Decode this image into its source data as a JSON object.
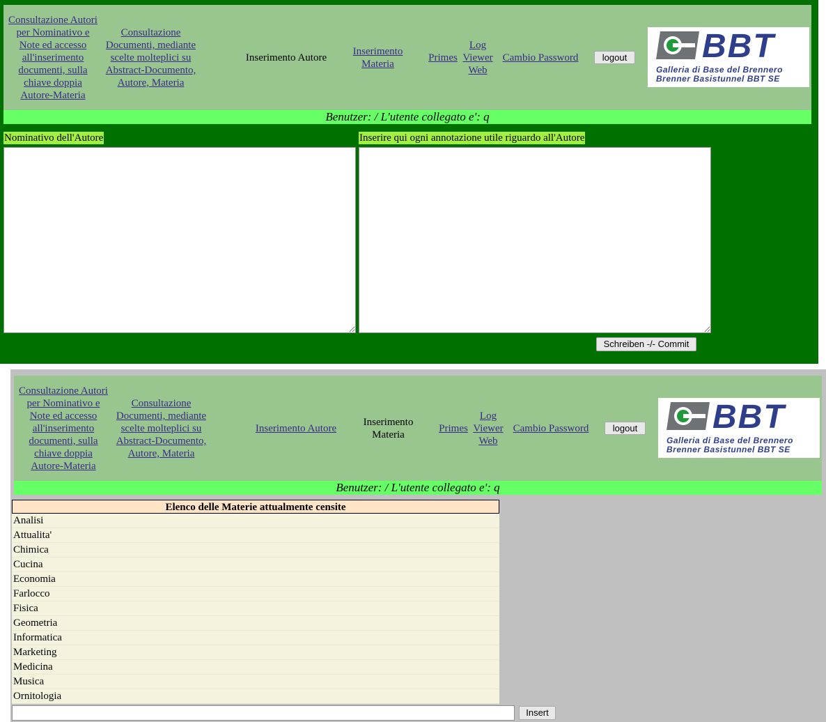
{
  "nav": {
    "consult_autori": "Consultazione Autori per Nominativo e Note ed accesso all'inserimento documenti, sulla chiave doppia Autore-Materia",
    "consult_documenti": "Consultazione Documenti, mediante scelte molteplici su Abstract-Documento, Autore, Materia",
    "inserimento_autore": "Inserimento Autore",
    "inserimento_materia": "Inserimento Materia",
    "primes": "Primes",
    "log_viewer_web": "Log Viewer Web",
    "cambio_password": "Cambio Password",
    "logout": "logout"
  },
  "logo": {
    "word": "BBT",
    "line1": "Galleria di Base del Brennero",
    "line2": "Brenner Basistunnel  BBT SE"
  },
  "user_bar": "Benutzer: / L'utente collegato e': q",
  "author_form": {
    "name_label": "Nominativo dell'Autore",
    "notes_label": "Inserire qui ogni annotazione utile riguardo all'Autore",
    "commit_button": "Schreiben -/- Commit"
  },
  "subjects": {
    "header": "Elenco delle Materie attualmente censite",
    "items": [
      "Analisi",
      "Attualita'",
      "Chimica",
      "Cucina",
      "Economia",
      "Farlocco",
      "Fisica",
      "Geometria",
      "Informatica",
      "Marketing",
      "Medicina",
      "Musica",
      "Ornitologia"
    ],
    "insert_button": "Insert"
  },
  "colors": {
    "page_green": "#007000",
    "header_bg": "#99c68f",
    "user_bar_bg": "#66ff66",
    "label_highlight": "#a3f040",
    "page_grey": "#c0c0c0",
    "table_header_bg": "#ffe4c8",
    "table_row_bg": "#f5f3de",
    "link": "#3a2a8a",
    "logo_blue": "#2e3e8a"
  }
}
